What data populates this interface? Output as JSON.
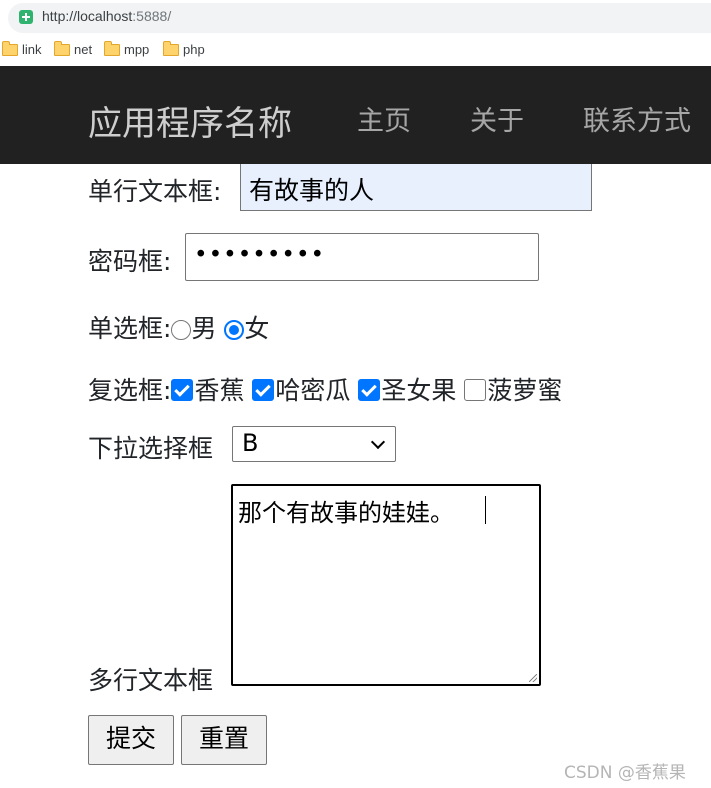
{
  "browser": {
    "url_host": "http://localhost",
    "url_port": ":5888/",
    "bookmarks": [
      "link",
      "net",
      "mpp",
      "php"
    ]
  },
  "navbar": {
    "brand": "应用程序名称",
    "links": [
      "主页",
      "关于",
      "联系方式"
    ]
  },
  "form": {
    "text_label": "单行文本框:",
    "text_value": "有故事的人",
    "password_label": "密码框:",
    "password_value": "•••••••••",
    "radio_label": "单选框:",
    "radio_options": [
      {
        "label": "男",
        "checked": false
      },
      {
        "label": "女",
        "checked": true
      }
    ],
    "checkbox_label": "复选框:",
    "checkbox_options": [
      {
        "label": "香蕉",
        "checked": true
      },
      {
        "label": "哈密瓜",
        "checked": true
      },
      {
        "label": "圣女果",
        "checked": true
      },
      {
        "label": "菠萝蜜",
        "checked": false
      }
    ],
    "select_label": "下拉选择框",
    "select_value": "B",
    "textarea_label": "多行文本框",
    "textarea_value": "那个有故事的娃娃。",
    "submit_label": "提交",
    "reset_label": "重置"
  },
  "watermark": "CSDN @香蕉果"
}
